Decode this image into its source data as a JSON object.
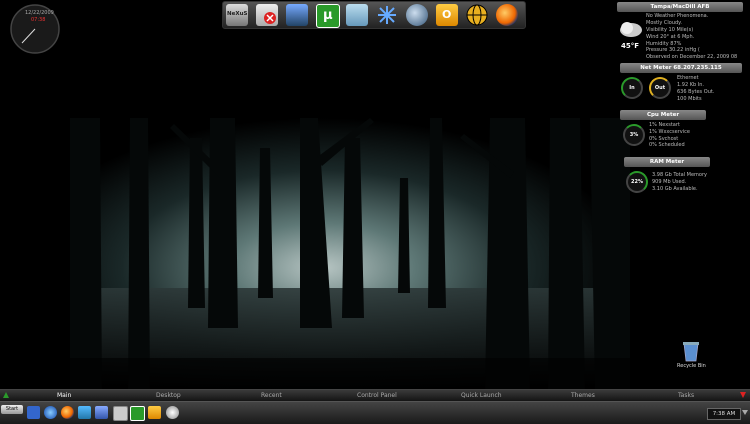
{
  "clock": {
    "date": "12/22/2009",
    "time": "07:38"
  },
  "dock": {
    "items": [
      {
        "name": "nexus-icon",
        "label": "NeXuS"
      },
      {
        "name": "uninstall-icon",
        "label": ""
      },
      {
        "name": "printer-icon",
        "label": ""
      },
      {
        "name": "utorrent-icon",
        "label": "µ"
      },
      {
        "name": "notepad-icon",
        "label": ""
      },
      {
        "name": "snowflake-icon",
        "label": ""
      },
      {
        "name": "messenger-icon",
        "label": ""
      },
      {
        "name": "outlook-icon",
        "label": "O"
      },
      {
        "name": "network-globe-icon",
        "label": ""
      },
      {
        "name": "firefox-icon",
        "label": ""
      }
    ]
  },
  "weather": {
    "title": "Tampa/MacDill AFB",
    "temp": "45°F",
    "lines": [
      "No Weather Phenomena.",
      "Mostly Cloudy.",
      "Visibility 10 Mile(s)",
      "Wind 20° at 6 Mph.",
      "Humidity 87%",
      "Pressure 30.22 inHg (",
      "Observed on December 22, 2009 08"
    ]
  },
  "net_meter": {
    "title": "Net Meter 68.207.235.115",
    "in_label": "In",
    "out_label": "Out",
    "lines": [
      "Ethernet",
      "1.92 Kb In.",
      "636 Bytes Out.",
      "100 Mbits"
    ]
  },
  "cpu_meter": {
    "title": "Cpu Meter",
    "value": "3%",
    "lines": [
      "1% Nexstart",
      "1% Wxxcservice",
      "0% Svchost",
      "0% Scheduled"
    ]
  },
  "ram_meter": {
    "title": "RAM Meter",
    "value": "22%",
    "lines": [
      "3.98 Gb Total Memory",
      "909 Mb Used.",
      "3.10 Gb Available."
    ]
  },
  "recycle_bin": {
    "label": "Recycle Bin"
  },
  "menu": {
    "items": [
      "Main",
      "Desktop",
      "Recent",
      "Control Panel",
      "Quick Launch",
      "Themes",
      "Tasks"
    ]
  },
  "taskbar": {
    "start_label": "Start",
    "time": "7:38 AM"
  },
  "colors": {
    "accent_green": "#2a9a2a",
    "clock_red": "#dd3333",
    "gauge_yellow": "#e0b020"
  }
}
